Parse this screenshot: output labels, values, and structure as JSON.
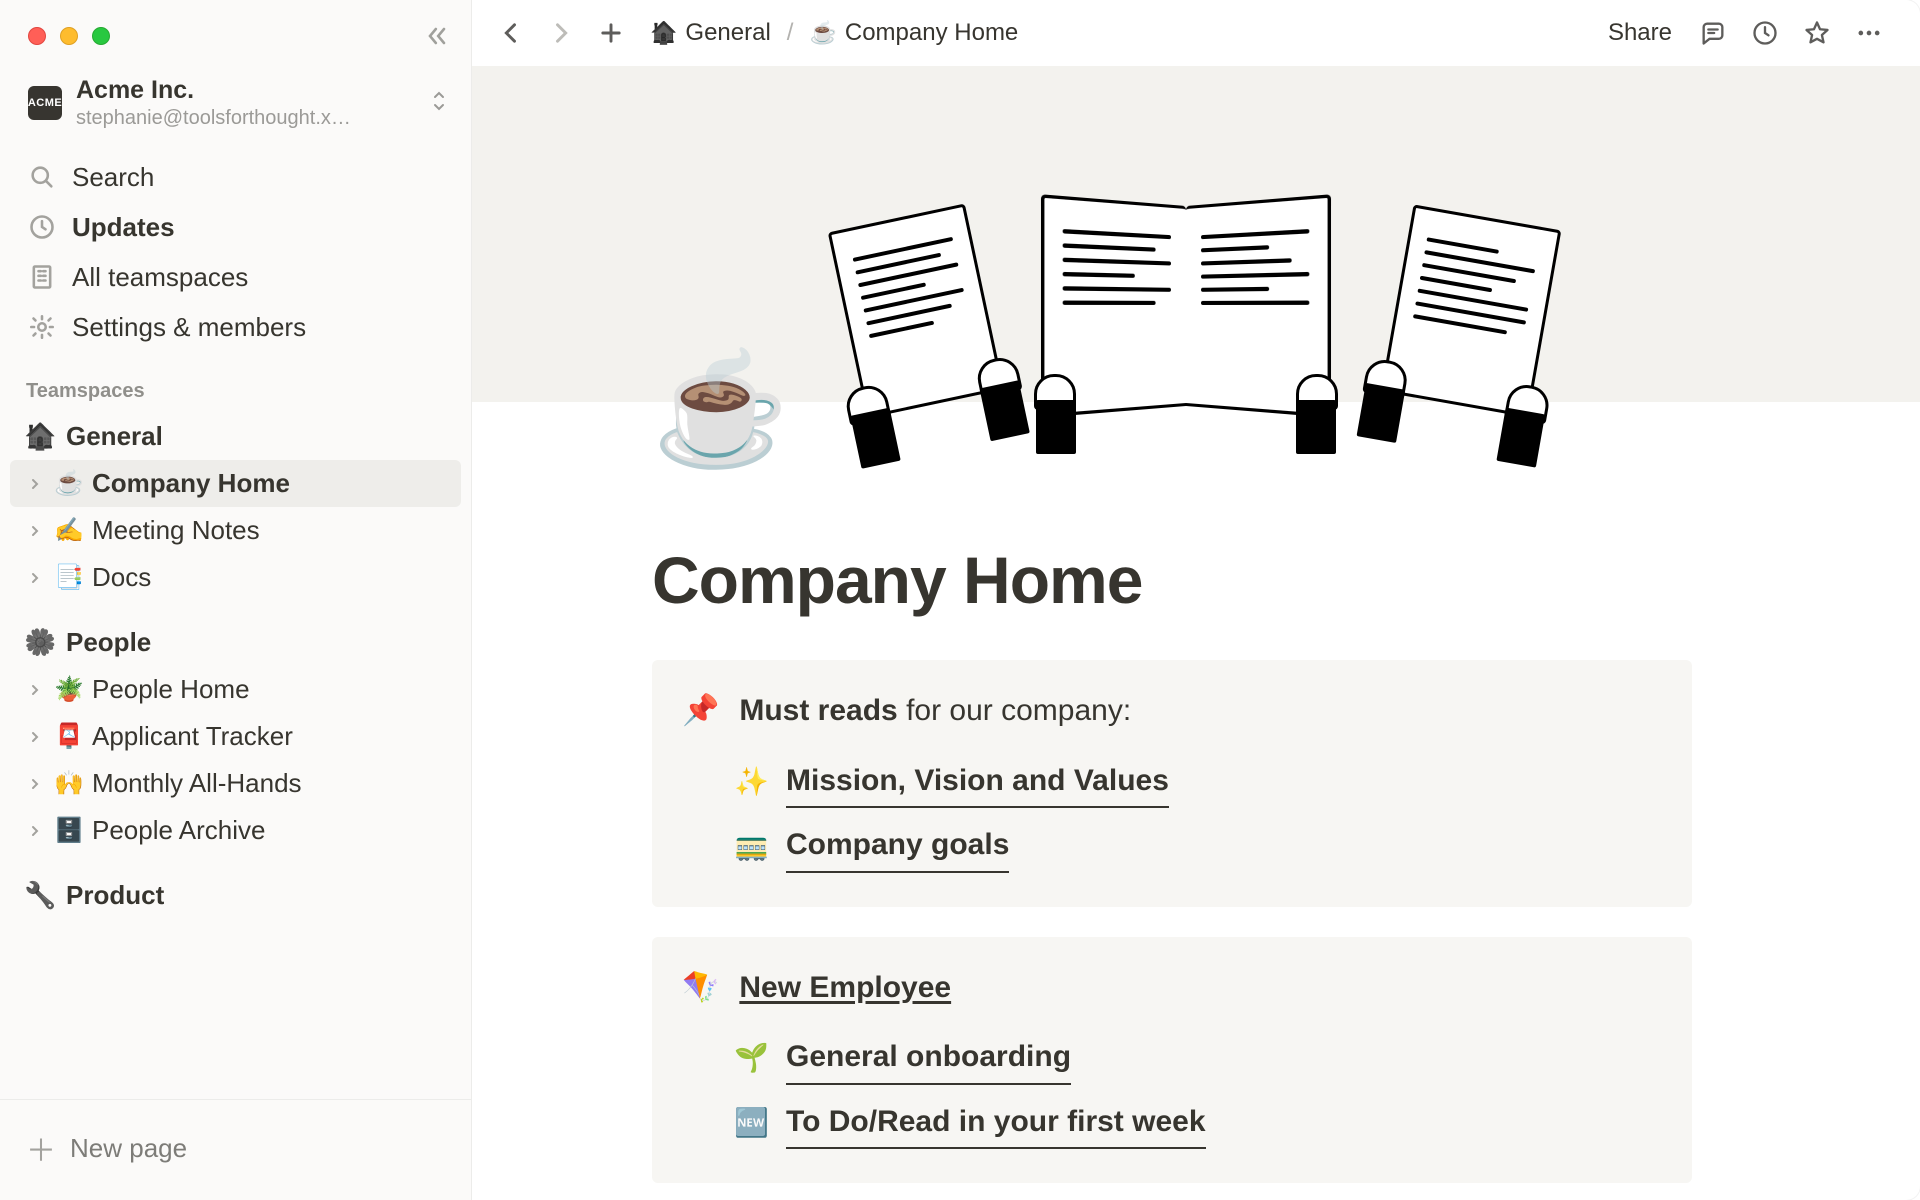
{
  "workspace": {
    "badge": "ACME",
    "name": "Acme Inc.",
    "email": "stephanie@toolsforthought.x…"
  },
  "nav": {
    "search": "Search",
    "updates": "Updates",
    "teamspaces": "All teamspaces",
    "settings": "Settings & members"
  },
  "sections": {
    "teamspaces": "Teamspaces"
  },
  "tree": {
    "general": {
      "emoji": "🏠",
      "label": "General"
    },
    "general_children": [
      {
        "emoji": "☕",
        "label": "Company Home",
        "active": true
      },
      {
        "emoji": "✍️",
        "label": "Meeting Notes"
      },
      {
        "emoji": "📑",
        "label": "Docs"
      }
    ],
    "people": {
      "emoji": "🌼",
      "label": "People"
    },
    "people_children": [
      {
        "emoji": "🪴",
        "label": "People Home"
      },
      {
        "emoji": "📮",
        "label": "Applicant Tracker"
      },
      {
        "emoji": "🙌",
        "label": "Monthly All-Hands"
      },
      {
        "emoji": "🗄️",
        "label": "People Archive"
      }
    ],
    "product": {
      "emoji": "🔧",
      "label": "Product"
    }
  },
  "new_page": "New page",
  "breadcrumb": {
    "parent_emoji": "🏠",
    "parent": "General",
    "sep": "/",
    "current_emoji": "☕",
    "current": "Company Home"
  },
  "topbar": {
    "share": "Share"
  },
  "page": {
    "icon": "☕",
    "title": "Company Home",
    "callouts": [
      {
        "lead_emoji": "📌",
        "heading_strong": "Must reads",
        "heading_plain": " for our company:",
        "heading_is_link": false,
        "items": [
          {
            "emoji": "✨",
            "text": "Mission, Vision and Values"
          },
          {
            "emoji": "🚃",
            "text": "Company goals"
          }
        ]
      },
      {
        "lead_emoji": "🪁",
        "heading_strong": "New Employee",
        "heading_plain": "",
        "heading_is_link": true,
        "items": [
          {
            "emoji": "🌱",
            "text": "General onboarding"
          },
          {
            "emoji": "🆕",
            "text": "To Do/Read in your first week"
          }
        ]
      }
    ]
  }
}
